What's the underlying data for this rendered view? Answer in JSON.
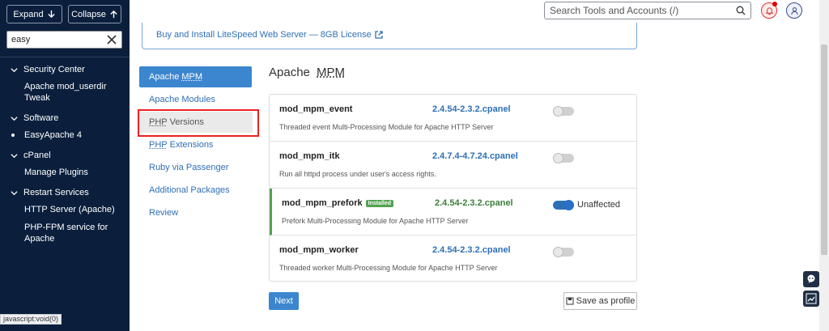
{
  "sidebar": {
    "expand_label": "Expand",
    "collapse_label": "Collapse",
    "search_value": "easy",
    "categories": [
      {
        "label": "Security Center",
        "items": [
          "Apache mod_userdir Tweak"
        ]
      },
      {
        "label": "Software",
        "items": [
          "EasyApache 4"
        ]
      },
      {
        "label": "cPanel",
        "items": [
          "Manage Plugins"
        ]
      },
      {
        "label": "Restart Services",
        "items": [
          "HTTP Server (Apache)",
          "PHP-FPM service for Apache"
        ]
      }
    ]
  },
  "status_bar": "javascript:void(0)",
  "header": {
    "search_placeholder": "Search Tools and Accounts (/)"
  },
  "banner": {
    "link_text": "Buy and Install LiteSpeed Web Server — 8GB License"
  },
  "nav": {
    "items": [
      {
        "abbr": "",
        "label": "Apache ",
        "abbr_suffix": "MPM"
      },
      {
        "label": "Apache Modules"
      },
      {
        "abbr": "PHP",
        "label": " Versions"
      },
      {
        "abbr": "PHP",
        "label": " Extensions"
      },
      {
        "label": "Ruby via Passenger"
      },
      {
        "label": "Additional Packages"
      },
      {
        "label": "Review"
      }
    ]
  },
  "panel": {
    "title_prefix": "Apache ",
    "title_abbr": "MPM",
    "modules": [
      {
        "name": "mod_mpm_event",
        "version": "2.4.54-2.3.2.cpanel",
        "description": "Threaded event Multi-Processing Module for Apache HTTP Server",
        "enabled": false
      },
      {
        "name": "mod_mpm_itk",
        "version": "2.4.7.4-4.7.24.cpanel",
        "description": "Run all httpd process under user's access rights.",
        "enabled": false
      },
      {
        "name": "mod_mpm_prefork",
        "badge": "Installed",
        "version": "2.4.54-2.3.2.cpanel",
        "description": "Prefork Multi-Processing Module for Apache HTTP Server",
        "enabled": true,
        "state": "Unaffected"
      },
      {
        "name": "mod_mpm_worker",
        "version": "2.4.54-2.3.2.cpanel",
        "description": "Threaded worker Multi-Processing Module for Apache HTTP Server",
        "enabled": false
      }
    ],
    "next_label": "Next",
    "save_profile_label": "Save as profile"
  },
  "colors": {
    "sidebar_bg": "#0b1f3d",
    "accent": "#3b86cf",
    "installed_green": "#52a350",
    "highlight_red": "#e22222"
  }
}
